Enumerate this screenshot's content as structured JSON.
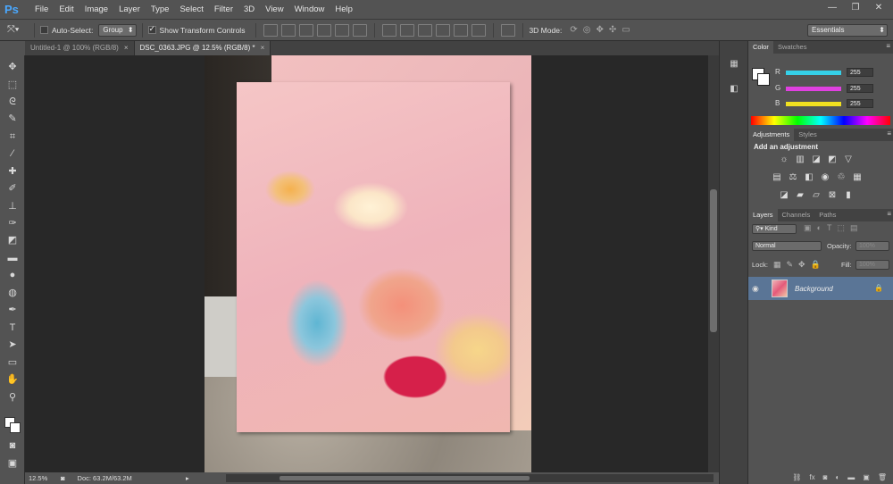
{
  "app": {
    "logo": "Ps"
  },
  "menu": [
    "File",
    "Edit",
    "Image",
    "Layer",
    "Type",
    "Select",
    "Filter",
    "3D",
    "View",
    "Window",
    "Help"
  ],
  "options": {
    "auto_select_label": "Auto-Select:",
    "auto_select_value": "Group",
    "show_transform_label": "Show Transform Controls",
    "mode_3d_label": "3D Mode:",
    "workspace": "Essentials"
  },
  "tabs": [
    {
      "label": "Untitled-1 @ 100% (RGB/8)",
      "close": "×"
    },
    {
      "label": "DSC_0363.JPG @ 12.5% (RGB/8) *",
      "close": "×"
    }
  ],
  "status": {
    "zoom": "12.5%",
    "doc": "Doc: 63.2M/63.2M"
  },
  "color_panel": {
    "tabs": [
      "Color",
      "Swatches"
    ],
    "r_label": "R",
    "g_label": "G",
    "b_label": "B",
    "r": "255",
    "g": "255",
    "b": "255",
    "r_color": "#35d0e8",
    "g_color": "#e040e0",
    "b_color": "#f0e020"
  },
  "adjustments": {
    "tabs": [
      "Adjustments",
      "Styles"
    ],
    "title": "Add an adjustment"
  },
  "layers": {
    "tabs": [
      "Layers",
      "Channels",
      "Paths"
    ],
    "kind": "Kind",
    "blend": "Normal",
    "opacity_label": "Opacity:",
    "opacity": "100%",
    "lock_label": "Lock:",
    "fill_label": "Fill:",
    "fill": "100%",
    "layer_name": "Background"
  }
}
